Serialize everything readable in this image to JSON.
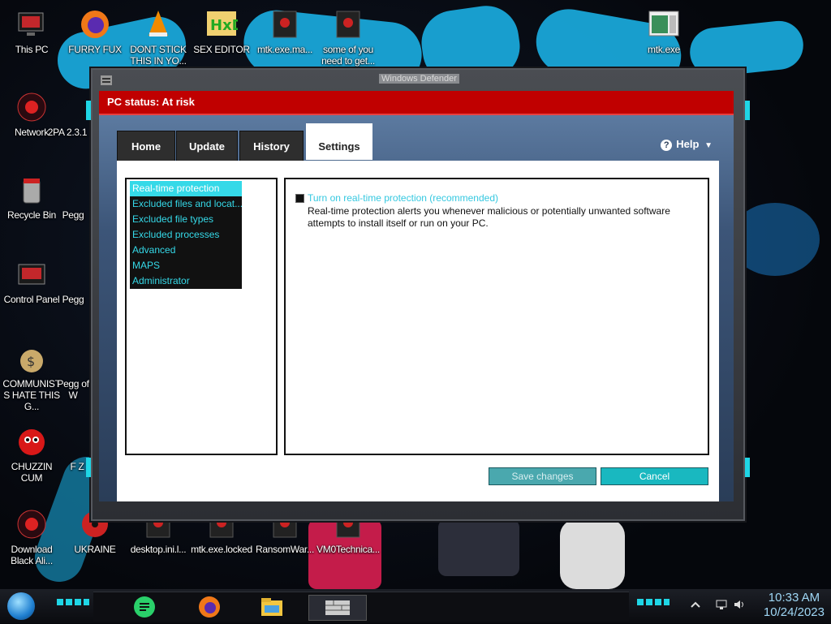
{
  "desktop": {
    "icons": [
      {
        "name": "this-pc-icon",
        "label": "This PC"
      },
      {
        "name": "furry-fux-icon",
        "label": "FURRY FUX"
      },
      {
        "name": "dont-stick-icon",
        "label": "DONT STICK THIS IN YO..."
      },
      {
        "name": "sex-editor-icon",
        "label": "SEX EDITOR"
      },
      {
        "name": "mtk-exe-ma-icon",
        "label": "mtk.exe.ma..."
      },
      {
        "name": "some-of-you-icon",
        "label": "some of you need to get..."
      },
      {
        "name": "mtk-exe-icon",
        "label": "mtk.exe"
      },
      {
        "name": "network-icon",
        "label": "Network"
      },
      {
        "name": "2pac-icon",
        "label": "2PA 2.3.1"
      },
      {
        "name": "recycle-bin-icon",
        "label": "Recycle Bin"
      },
      {
        "name": "pegg-1-icon",
        "label": "Pegg"
      },
      {
        "name": "control-panel-icon",
        "label": "Control Panel"
      },
      {
        "name": "pegg-2-icon",
        "label": "Pegg"
      },
      {
        "name": "communists-icon",
        "label": "COMMUNISTS HATE THIS G..."
      },
      {
        "name": "pegg-3-icon",
        "label": "Pegg of W"
      },
      {
        "name": "chuzzin-cum-icon",
        "label": "CHUZZIN CUM"
      },
      {
        "name": "f-z-icon",
        "label": "F Z"
      },
      {
        "name": "download-black-icon",
        "label": "Download Black Ali..."
      },
      {
        "name": "ukraine-icon",
        "label": "UKRAINE"
      },
      {
        "name": "desktop-ini-icon",
        "label": "desktop.ini.l..."
      },
      {
        "name": "mtk-exe-locked-icon",
        "label": "mtk.exe.locked"
      },
      {
        "name": "ransomware-icon",
        "label": "RansomWar..."
      },
      {
        "name": "vm0technical-icon",
        "label": "VM0Technica..."
      }
    ]
  },
  "window": {
    "title": "Windows Defender",
    "status": "PC status: At risk",
    "tabs": [
      "Home",
      "Update",
      "History",
      "Settings"
    ],
    "active_tab": "Settings",
    "help_label": "Help",
    "settings_nav": [
      "Real-time protection",
      "Excluded files and locat...",
      "Excluded file types",
      "Excluded processes",
      "Advanced",
      "MAPS",
      "Administrator"
    ],
    "selected_nav": "Real-time protection",
    "realtime": {
      "checkbox_label": "Turn on real-time protection (recommended)",
      "checked": true,
      "description": "Real-time protection alerts you whenever malicious or potentially unwanted software attempts to install itself or run on your PC."
    },
    "save_label": "Save changes",
    "cancel_label": "Cancel"
  },
  "taskbar": {
    "apps": [
      "notes-app-icon",
      "firefox-icon",
      "file-explorer-icon",
      "wall-app-icon"
    ],
    "time": "10:33 AM",
    "date": "10/24/2023"
  },
  "colors": {
    "accent": "#35d9e8",
    "status_red": "#c00000",
    "wallpaper_blue": "#19a7d8"
  }
}
